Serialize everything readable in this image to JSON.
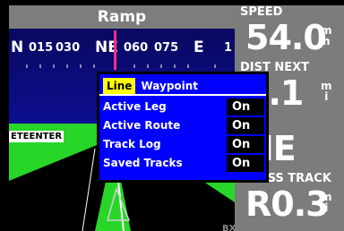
{
  "map": {
    "title": "Ramp",
    "compass": {
      "marks": [
        "N",
        "015",
        "030",
        "NE",
        "060",
        "075",
        "E",
        "1"
      ]
    },
    "side_label": "ETEENTER",
    "bottom_label": "BX"
  },
  "data_fields": [
    {
      "label": "SPEED",
      "value": "54.0",
      "unit_top": "m",
      "unit_bottom": "h"
    },
    {
      "label": "DIST NEXT",
      "value": "1.1",
      "unit_top": "m",
      "unit_bottom": "i"
    },
    {
      "label": "ER",
      "value": "NE",
      "unit_top": "",
      "unit_bottom": ""
    },
    {
      "label": "CROSS TRACK",
      "value": "R0.3",
      "unit_top": "m",
      "unit_bottom": "i"
    }
  ],
  "popup": {
    "tabs": [
      {
        "label": "Line",
        "active": true
      },
      {
        "label": "Waypoint",
        "active": false
      }
    ],
    "rows": [
      {
        "label": "Active Leg",
        "value": "On"
      },
      {
        "label": "Active Route",
        "value": "On"
      },
      {
        "label": "Track Log",
        "value": "On"
      },
      {
        "label": "Saved Tracks",
        "value": "On"
      }
    ]
  },
  "colors": {
    "sky": "#0e0f9a",
    "ground": "#28d628",
    "popup_bg": "#0000ff",
    "tab_active": "#ffff00",
    "compass_marker": "#ff2b8a",
    "field_bg": "#7c7c7c"
  }
}
